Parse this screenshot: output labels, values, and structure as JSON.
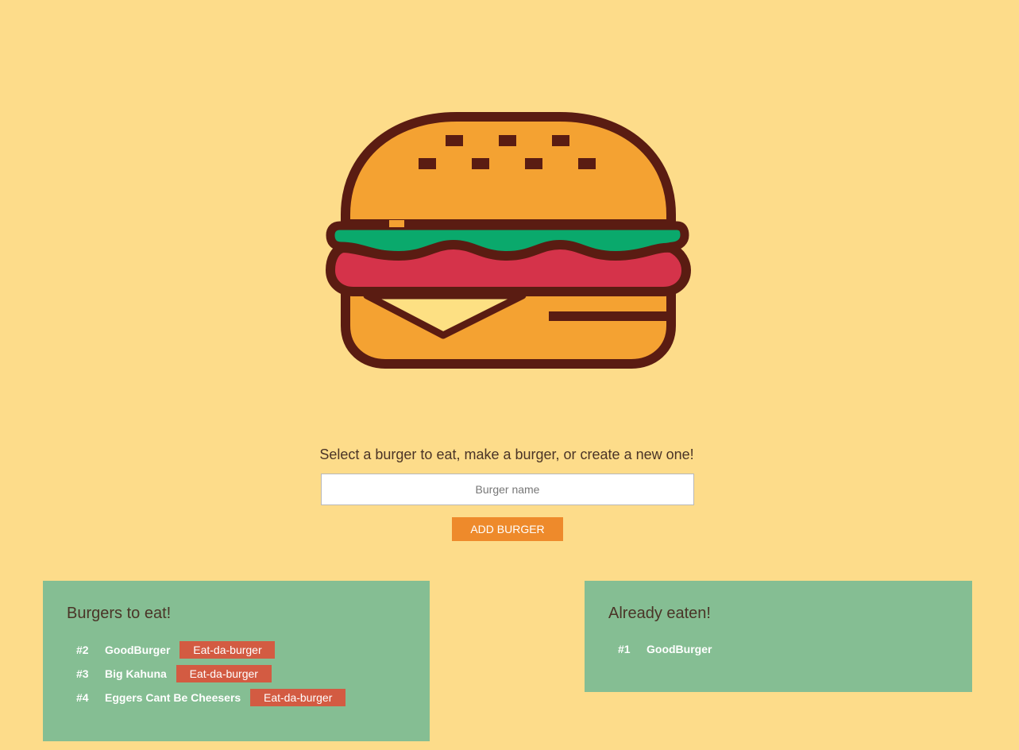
{
  "colors": {
    "background": "#fddc8a",
    "panel": "#85be93",
    "add_button": "#ee8a2b",
    "eat_button": "#d35b42",
    "outline": "#5a1c12",
    "bun": "#f4a232",
    "lettuce": "#0aa96c",
    "patty": "#d5334a",
    "cheese": "#fde083"
  },
  "logo": {
    "icon": "burger-icon"
  },
  "form": {
    "prompt": "Select a burger to eat, make a burger, or create a new one!",
    "input_placeholder": "Burger name",
    "input_value": "",
    "add_button_label": "ADD BURGER"
  },
  "to_eat": {
    "title": "Burgers to eat!",
    "items": [
      {
        "number": "#2",
        "name": "GoodBurger",
        "button": "Eat-da-burger"
      },
      {
        "number": "#3",
        "name": "Big Kahuna",
        "button": "Eat-da-burger"
      },
      {
        "number": "#4",
        "name": "Eggers Cant Be Cheesers",
        "button": "Eat-da-burger"
      }
    ]
  },
  "eaten": {
    "title": "Already eaten!",
    "items": [
      {
        "number": "#1",
        "name": "GoodBurger"
      }
    ]
  }
}
